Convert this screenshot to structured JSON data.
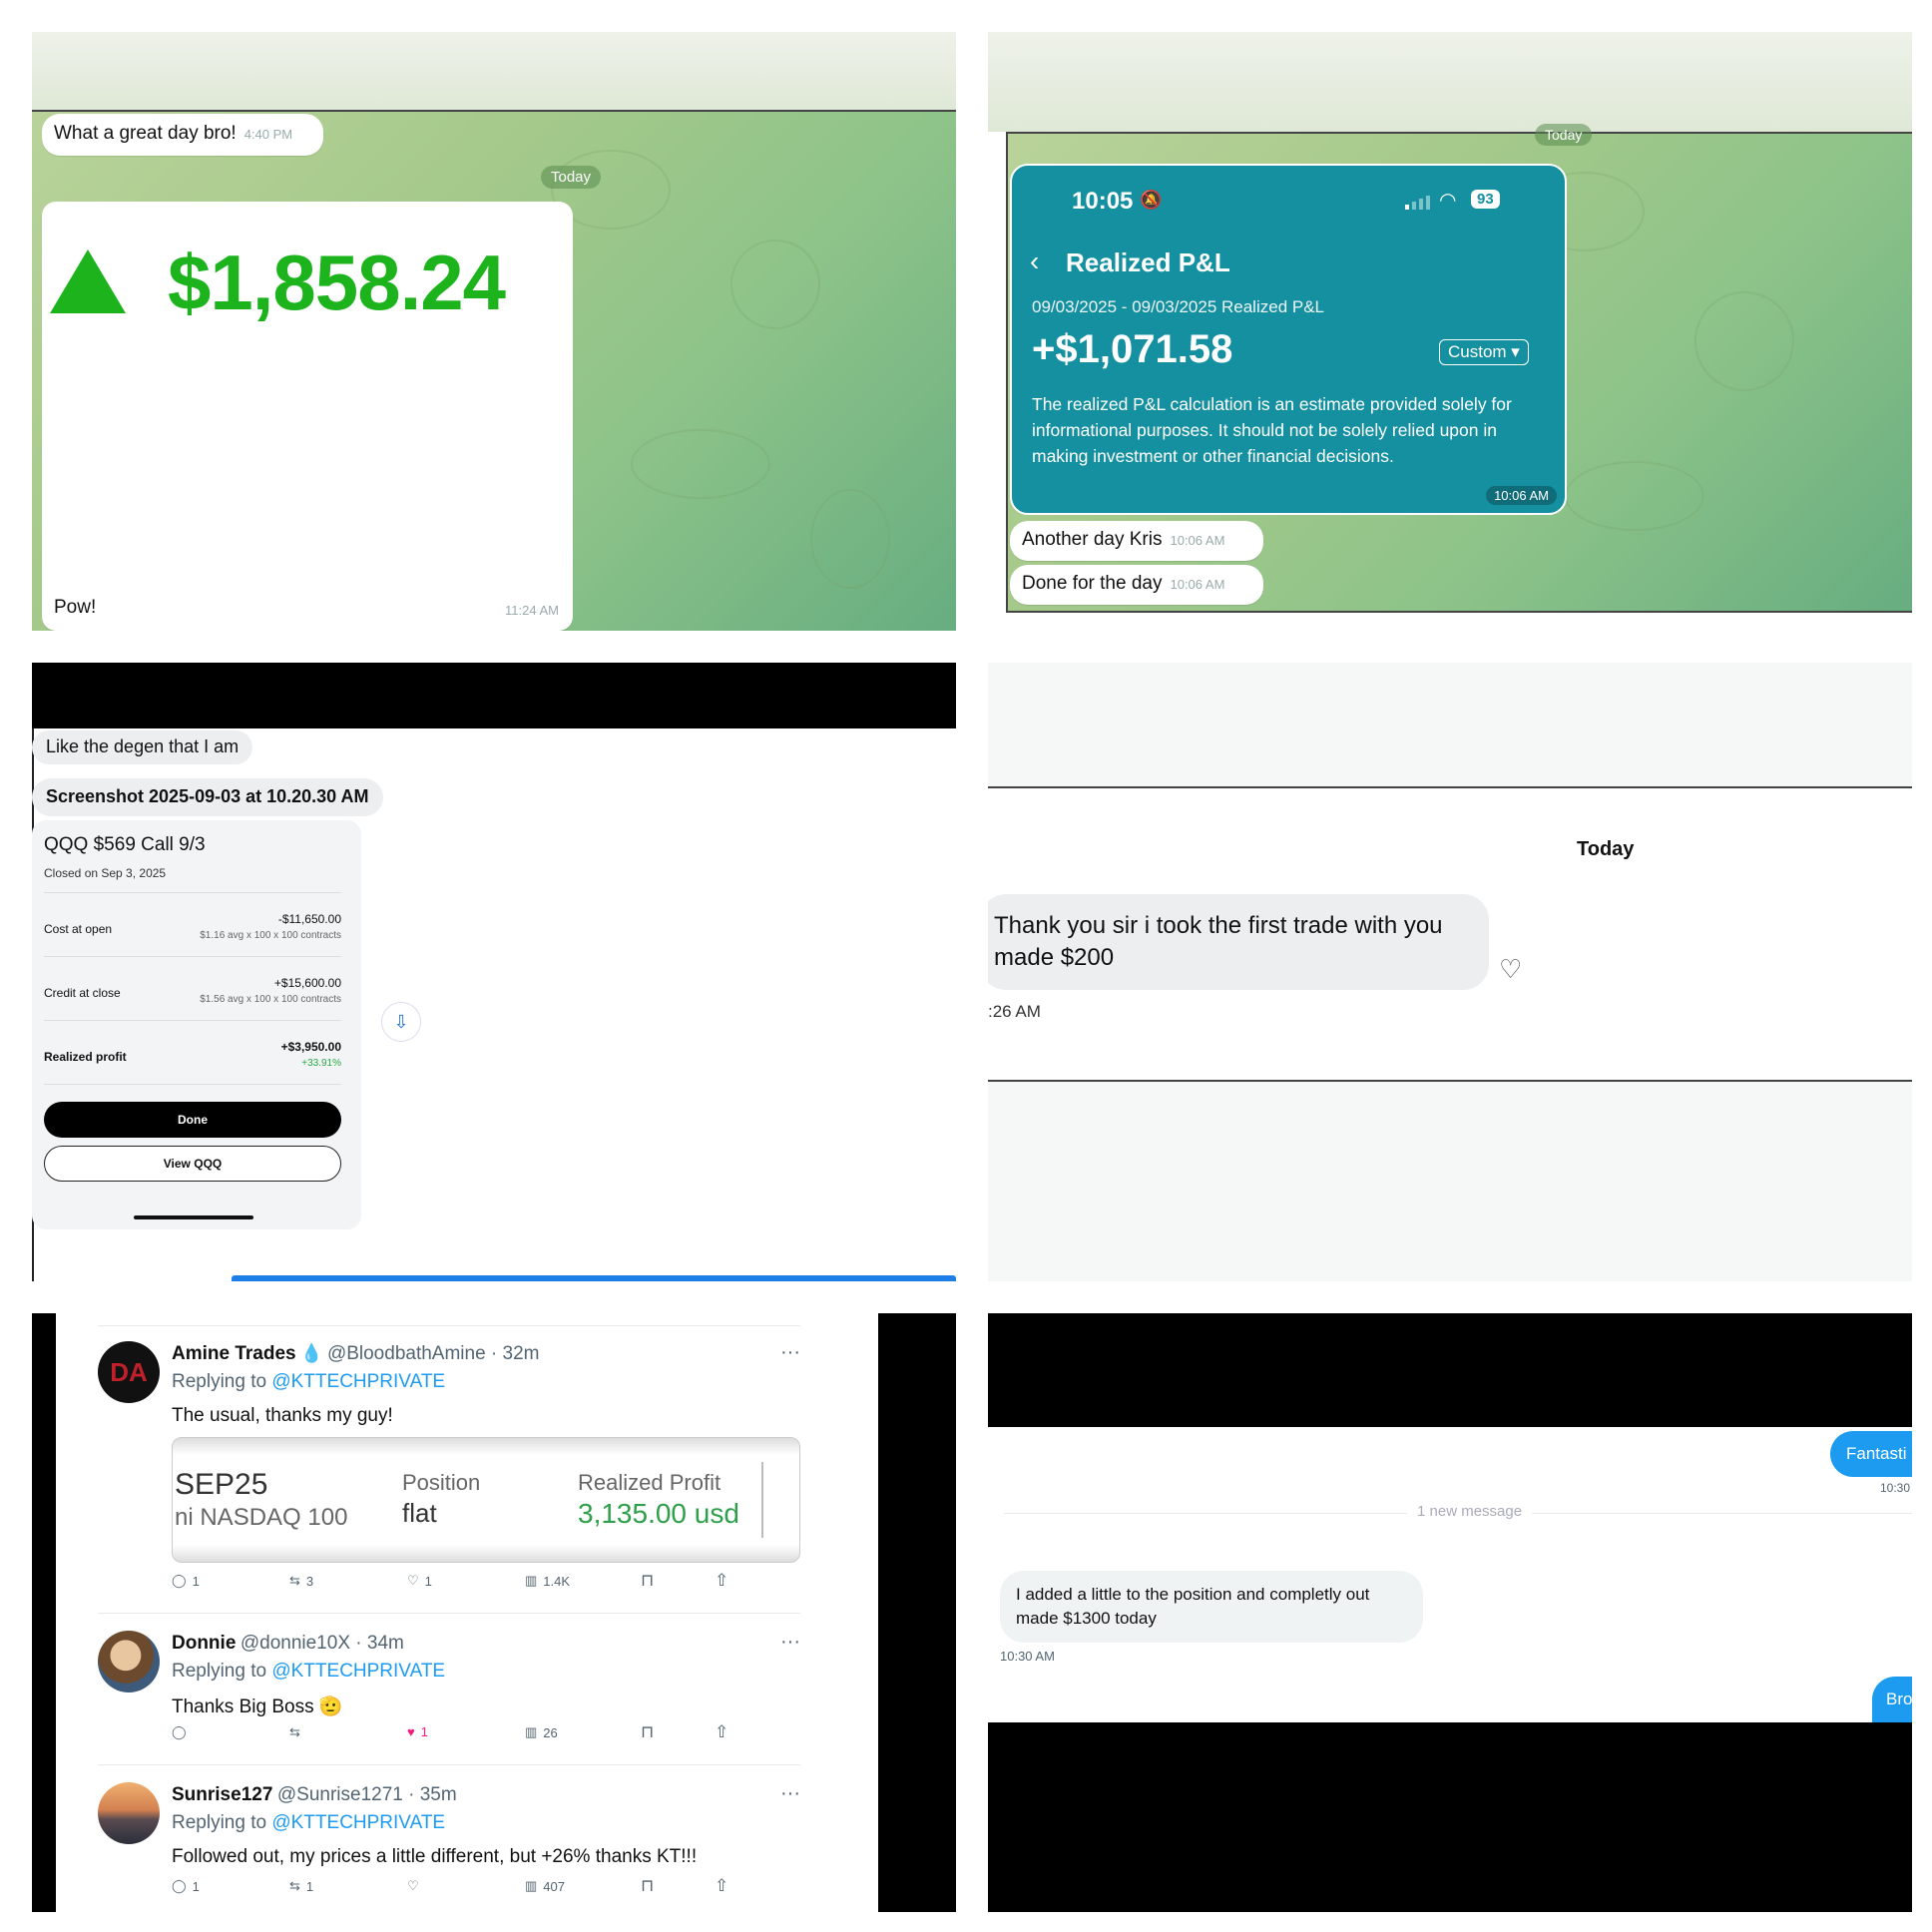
{
  "panel1": {
    "top_message": "What a great day bro!",
    "top_time": "4:40 PM",
    "date_pill": "Today",
    "amount": "$1,858.24",
    "caption": "Pow!",
    "caption_time": "11:24 AM",
    "colors": {
      "gain": "#1db31d"
    }
  },
  "panel2": {
    "date_pill": "Today",
    "status_time": "10:05",
    "battery": "93",
    "screen_title": "Realized P&L",
    "date_range": "09/03/2025 - 09/03/2025 Realized P&L",
    "pnl_value": "+$1,071.58",
    "range_button": "Custom ▾",
    "disclaimer": "The realized P&L calculation is an estimate provided solely for informational purposes. It should not be solely relied upon in making investment or other financial decisions.",
    "card_time": "10:06 AM",
    "messages": [
      {
        "text": "Another day Kris",
        "time": "10:06 AM"
      },
      {
        "text": "Done for the day",
        "time": "10:06 AM"
      }
    ],
    "colors": {
      "card": "#1590a0"
    }
  },
  "panel3": {
    "message1": "Like the degen that I am",
    "file_name": "Screenshot 2025-09-03 at 10.20.30 AM",
    "contract": "QQQ $569 Call 9/3",
    "closed_on": "Closed on Sep 3, 2025",
    "rows": [
      {
        "label": "Cost at open",
        "value": "-$11,650.00",
        "detail": "$1.16 avg x 100 x 100 contracts"
      },
      {
        "label": "Credit at close",
        "value": "+$15,600.00",
        "detail": "$1.56 avg x 100 x 100 contracts"
      },
      {
        "label": "Realized profit",
        "value": "+$3,950.00",
        "detail": "+33.91%"
      }
    ],
    "done_button": "Done",
    "view_button": "View QQQ"
  },
  "panel4": {
    "date_label": "Today",
    "message": "Thank you sir i took the  first trade with you made $200",
    "time": ":26 AM"
  },
  "panel5": {
    "tweets": [
      {
        "name": "Amine Trades",
        "handle": "@BloodbathAmine",
        "age": "32m",
        "reply_prefix": "Replying to",
        "reply_to": "@KTTECHPRIVATE",
        "text": "The usual, thanks my guy!",
        "counts": {
          "reply": "1",
          "retweet": "3",
          "like": "1",
          "views": "1.4K"
        }
      },
      {
        "name": "Donnie",
        "handle": "@donnie10X",
        "age": "34m",
        "reply_prefix": "Replying to",
        "reply_to": "@KTTECHPRIVATE",
        "text": "Thanks Big Boss 🫡",
        "counts": {
          "reply": "",
          "retweet": "",
          "like": "1",
          "views": "26"
        }
      },
      {
        "name": "Sunrise127",
        "handle": "@Sunrise1271",
        "age": "35m",
        "reply_prefix": "Replying to",
        "reply_to": "@KTTECHPRIVATE",
        "text": "Followed out, my prices a little different, but +26% thanks KT!!!",
        "counts": {
          "reply": "1",
          "retweet": "1",
          "like": "",
          "views": "407"
        }
      }
    ],
    "embed": {
      "symbol": "SEP25",
      "symbol_sub": "ni NASDAQ 100",
      "position_label": "Position",
      "position_value": "flat",
      "profit_label": "Realized Profit",
      "profit_value": "3,135.00 usd"
    }
  },
  "panel6": {
    "out_message_1": "Fantasti",
    "out_time_1": "10:30",
    "divider": "1 new message",
    "in_message": "I added a little to the position and completly out made $1300 today",
    "in_time": "10:30 AM",
    "out_message_2": "Bro",
    "colors": {
      "blue": "#1d9bf0"
    }
  }
}
